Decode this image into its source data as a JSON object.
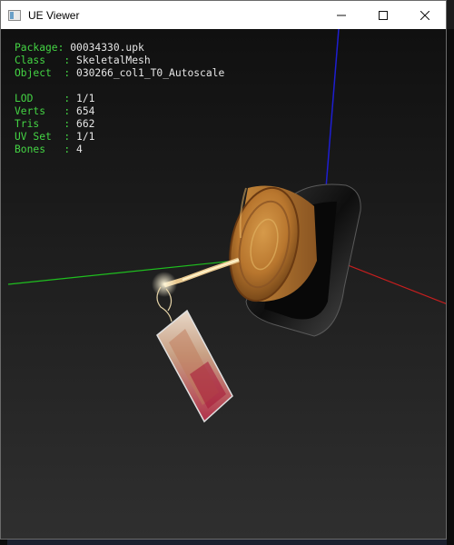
{
  "window": {
    "title": "UE Viewer",
    "controls": {
      "minimize": "—",
      "maximize": "☐",
      "close": "✕"
    }
  },
  "info": {
    "package": {
      "label": "Package: ",
      "value": "00034330.upk"
    },
    "class": {
      "label": "Class   : ",
      "value": "SkeletalMesh"
    },
    "object": {
      "label": "Object  : ",
      "value": "030266_col1_T0_Autoscale"
    },
    "lod": {
      "label": "LOD     : ",
      "value": "1/1"
    },
    "verts": {
      "label": "Verts   : ",
      "value": "654"
    },
    "tris": {
      "label": "Tris    : ",
      "value": "662"
    },
    "uvset": {
      "label": "UV Set  : ",
      "value": "1/1"
    },
    "bones": {
      "label": "Bones   : ",
      "value": "4"
    }
  },
  "colors": {
    "label_green": "#44d444",
    "axis_x": "#c81e1e",
    "axis_y": "#1fbf1f",
    "axis_z": "#1e1ed2"
  },
  "icons": [
    "app-window-icon",
    "minimize-icon",
    "maximize-icon",
    "close-icon"
  ]
}
